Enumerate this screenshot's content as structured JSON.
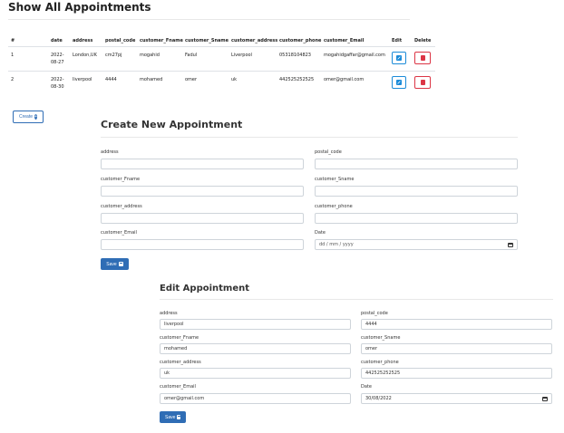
{
  "page": {
    "title": "Show All Appointments"
  },
  "table": {
    "headers": [
      "#",
      "date",
      "address",
      "postal_code",
      "customer_Fname",
      "customer_Sname",
      "customer_address",
      "customer_phone",
      "customer_Email",
      "Edit",
      "Delete"
    ],
    "rows": [
      {
        "id": "1",
        "date": "2022-08-27",
        "address": "London,UK",
        "postal_code": "cm27pj",
        "customer_Fname": "mogahid",
        "customer_Sname": "Fadul",
        "customer_address": "Liverpool",
        "customer_phone": "05318104823",
        "customer_Email": "mogahidgaffar@gmail.com"
      },
      {
        "id": "2",
        "date": "2022-08-30",
        "address": "liverpool",
        "postal_code": "4444",
        "customer_Fname": "mohamed",
        "customer_Sname": "omer",
        "customer_address": "uk",
        "customer_phone": "442525252525",
        "customer_Email": "omer@gmail.com"
      }
    ],
    "edit_icon": "pencil-square-icon",
    "delete_icon": "trash-icon"
  },
  "create_button": {
    "label": "Create",
    "icon": "plus-circle-icon"
  },
  "create_form": {
    "title": "Create New Appointment",
    "labels": {
      "address": "address",
      "postal_code": "postal_code",
      "customer_Fname": "customer_Fname",
      "customer_Sname": "customer_Sname",
      "customer_address": "customer_address",
      "customer_phone": "customer_phone",
      "customer_Email": "customer_Email",
      "date": "Date"
    },
    "date_placeholder": "dd / mm / yyyy",
    "save_label": "Save"
  },
  "edit_form": {
    "title": "Edit Appointment",
    "labels": {
      "address": "address",
      "postal_code": "postal_code",
      "customer_Fname": "customer_Fname",
      "customer_Sname": "customer_Sname",
      "customer_address": "customer_address",
      "customer_phone": "customer_phone",
      "customer_Email": "customer_Email",
      "date": "Date"
    },
    "values": {
      "address": "liverpool",
      "postal_code": "4444",
      "customer_Fname": "mohamed",
      "customer_Sname": "omer",
      "customer_address": "uk",
      "customer_phone": "442525252525",
      "customer_Email": "omer@gmail.com",
      "date": "30/08/2022"
    },
    "save_label": "Save"
  },
  "colors": {
    "primary": "#2f6db5",
    "edit": "#1b8bd8",
    "danger": "#dc3545"
  }
}
